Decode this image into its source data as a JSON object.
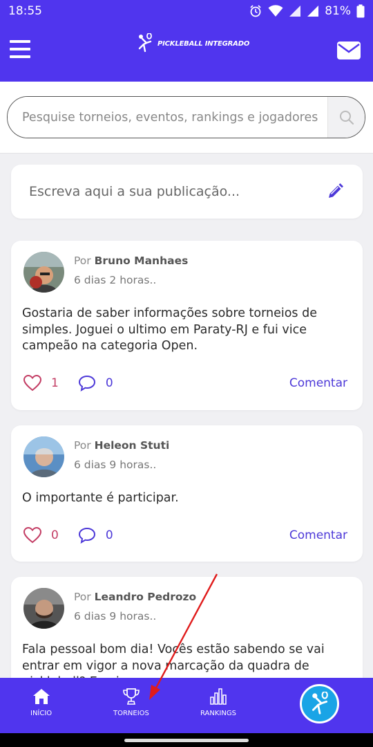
{
  "status_bar": {
    "time": "18:55",
    "battery": "81%"
  },
  "app_bar": {
    "logo_text": "PICKLEBALL INTEGRADO",
    "menu_icon": "hamburger-menu-icon",
    "mail_icon": "mail-icon"
  },
  "search": {
    "placeholder": "Pesquise torneios, eventos, rankings e jogadores",
    "icon": "search-icon"
  },
  "compose": {
    "placeholder": "Escreva aqui a sua publicação...",
    "icon": "pencil-icon"
  },
  "posts": [
    {
      "by": "Por",
      "author": "Bruno Manhaes",
      "time": "6 dias 2 horas..",
      "text": "Gostaria de saber informações sobre torneios de simples. Joguei o ultimo em Paraty-RJ e fui vice campeão na categoria Open.",
      "likes": "1",
      "comments": "0",
      "comment_label": "Comentar"
    },
    {
      "by": "Por",
      "author": "Heleon Stuti",
      "time": "6 dias 9 horas..",
      "text": "O importante é participar.",
      "likes": "0",
      "comments": "0",
      "comment_label": "Comentar"
    },
    {
      "by": "Por",
      "author": "Leandro Pedrozo",
      "time": "6 dias 9 horas..",
      "text": "Fala pessoal bom dia! Vocês estão sabendo se vai entrar em vigor a nova marcação da quadra de pickleball? Eu vi o"
    }
  ],
  "bottom_nav": {
    "items": [
      {
        "label": "INÍCIO",
        "icon": "home-icon"
      },
      {
        "label": "TORNEIOS",
        "icon": "trophy-icon"
      },
      {
        "label": "RANKINGS",
        "icon": "bar-chart-icon"
      }
    ],
    "fab_icon": "pickleball-player-icon"
  },
  "colors": {
    "brand": "#5035ee",
    "accent": "#4c38d8",
    "like": "#c33d64",
    "fab": "#1aa4e6",
    "annotation": "#e01b1b"
  }
}
